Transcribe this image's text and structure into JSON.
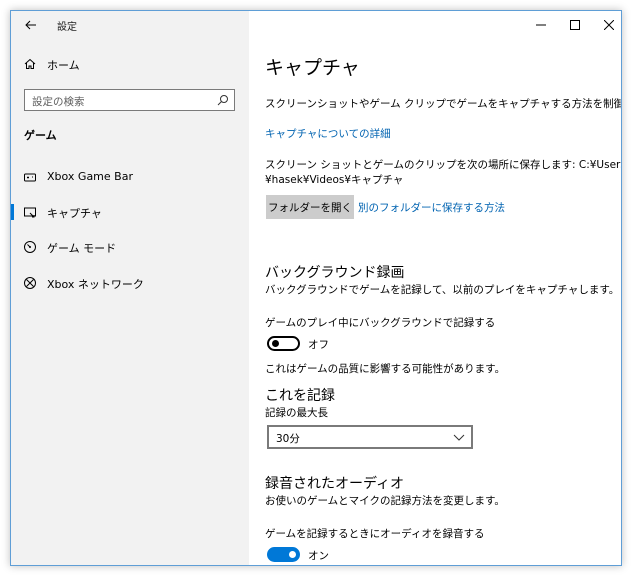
{
  "window": {
    "title": "設定"
  },
  "sidebar": {
    "home_label": "ホーム",
    "search_placeholder": "設定の検索",
    "section_label": "ゲーム",
    "items": [
      {
        "label": "Xbox Game Bar",
        "icon": "xbox-game-bar-icon"
      },
      {
        "label": "キャプチャ",
        "icon": "capture-icon",
        "selected": true
      },
      {
        "label": "ゲーム モード",
        "icon": "game-mode-icon"
      },
      {
        "label": "Xbox ネットワーク",
        "icon": "xbox-network-icon"
      }
    ]
  },
  "main": {
    "title": "キャプチャ",
    "description": "スクリーンショットやゲーム クリップでゲームをキャプチャする方法を制御します。",
    "learn_more_link": "キャプチャについての詳細",
    "save_location_line1": "スクリーン ショットとゲームのクリップを次の場所に保存します: C:¥Users",
    "save_location_line2": "¥hasek¥Videos¥キャプチャ",
    "open_folder_button": "フォルダーを開く",
    "other_folder_link": "別のフォルダーに保存する方法",
    "background": {
      "heading": "バックグラウンド録画",
      "description": "バックグラウンドでゲームを記録して、以前のプレイをキャプチャします。",
      "toggle_label": "ゲームのプレイ中にバックグラウンドで記録する",
      "toggle_state": "オフ",
      "note": "これはゲームの品質に影響する可能性があります。"
    },
    "record_this": {
      "heading": "これを記録",
      "max_length_label": "記録の最大長",
      "max_length_value": "30分"
    },
    "audio": {
      "heading": "録音されたオーディオ",
      "description": "お使いのゲームとマイクの記録方法を変更します。",
      "toggle_label": "ゲームを記録するときにオーディオを録音する",
      "toggle_state": "オン"
    }
  },
  "colors": {
    "accent": "#0078d7",
    "link": "#0063b1",
    "sidebar_bg": "#f2f2f2"
  }
}
